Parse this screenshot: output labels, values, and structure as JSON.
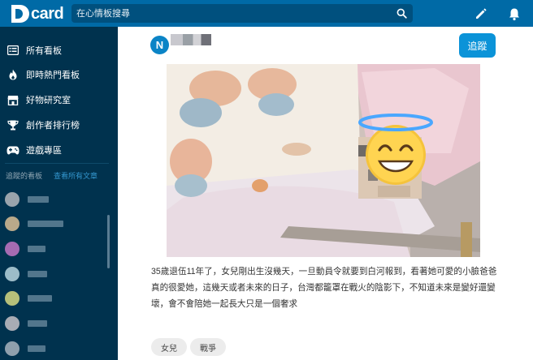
{
  "header": {
    "logo_text": "card",
    "search_placeholder": "在心情板搜尋"
  },
  "sidebar": {
    "items": [
      {
        "label": "所有看板",
        "icon": "list-icon"
      },
      {
        "label": "即時熱門看板",
        "icon": "fire-icon"
      },
      {
        "label": "好物研究室",
        "icon": "store-icon"
      },
      {
        "label": "創作者排行榜",
        "icon": "trophy-icon"
      },
      {
        "label": "遊戲專區",
        "icon": "gamepad-icon"
      }
    ],
    "followed_title": "追蹤的看板",
    "view_all_link": "查看所有文章"
  },
  "post": {
    "author_initial": "N",
    "follow_label": "追蹤",
    "body": "35歲退伍11年了，女兒剛出生沒幾天，一旦動員令就要到白河報到，看著她可愛的小臉爸爸真的很愛她，這幾天或者未來的日子，台灣都籠罩在戰火的陰影下，不知道未來是變好還變壞，會不會陪她一起長大只是一個奢求",
    "tags": [
      "女兒",
      "戰爭"
    ]
  },
  "colors": {
    "topbar": "#006aa6",
    "sidebar": "#00324e",
    "accent": "#0b93d8",
    "link": "#3397cf"
  }
}
